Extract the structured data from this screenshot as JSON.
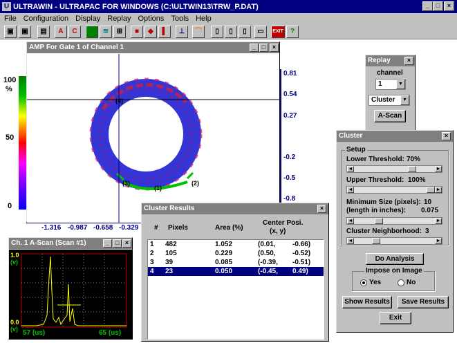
{
  "app": {
    "title": "ULTRAWIN - ULTRAPAC FOR WINDOWS   (C:\\ULTWIN13\\TRW_P.DAT)",
    "logo_letter": "U"
  },
  "menu": [
    "File",
    "Configuration",
    "Display",
    "Replay",
    "Options",
    "Tools",
    "Help"
  ],
  "toolbar": {
    "buttons": [
      "save-icon",
      "save-as-icon",
      "print-icon",
      "A",
      "C",
      "chart-icon",
      "scan-icon",
      "probe-icon",
      "record-icon",
      "diamond-icon",
      "marker-icon",
      "plot-icon",
      "rainbow-icon",
      "gauge-icon",
      "gauge-icon",
      "gauge-icon",
      "keyboard-icon",
      "EXIT",
      "?"
    ]
  },
  "amp_window": {
    "title": "AMP For Gate 1 of Channel 1",
    "colorbar_labels": [
      "100",
      "%",
      "50",
      "0"
    ],
    "y_ticks": [
      "0.81",
      "0.54",
      "0.27",
      "-0.2",
      "-0.5",
      "-0.8"
    ],
    "x_ticks": [
      "-1.316",
      "-0.987",
      "-0.658",
      "-0.329"
    ],
    "cluster_markers": [
      "(4)",
      "(3)",
      "(1)",
      "(2)"
    ]
  },
  "ascan_window": {
    "title": "Ch. 1 A-Scan (Scan #1)",
    "y_top": "1.0",
    "y_top_unit": "(v)",
    "y_bottom": "0.0",
    "y_bottom_unit": "(v)",
    "x_start": "57 (us)",
    "x_end": "65 (us)"
  },
  "replay": {
    "title": "Replay",
    "channel_label": "channel",
    "channel_value": "1",
    "mode_value": "Cluster",
    "ascan_button": "A-Scan"
  },
  "cluster_results": {
    "title": "Cluster Results",
    "headers": [
      "#",
      "Pixels",
      "Area (%)",
      "Center Posi.",
      "(x, y)"
    ],
    "rows": [
      {
        "n": "1",
        "pixels": "482",
        "area": "1.052",
        "x": "(0.01,",
        "y": "-0.66)"
      },
      {
        "n": "2",
        "pixels": "105",
        "area": "0.229",
        "x": "(0.50,",
        "y": "-0.52)"
      },
      {
        "n": "3",
        "pixels": "39",
        "area": "0.085",
        "x": "(-0.39,",
        "y": "-0.51)"
      },
      {
        "n": "4",
        "pixels": "23",
        "area": "0.050",
        "x": "(-0.45,",
        "y": "0.49)"
      }
    ],
    "selected_row": 3
  },
  "cluster": {
    "title": "Cluster",
    "setup_label": "Setup",
    "lower_label": "Lower Threshold:",
    "lower_value": "70%",
    "lower_fraction": 0.7,
    "upper_label": "Upper Threshold:",
    "upper_value": "100%",
    "upper_fraction": 1.0,
    "min_size_label": "Minimum Size (pixels):",
    "min_size_value": "10",
    "length_label": "(length in inches):",
    "length_value": "0.075",
    "neighborhood_label": "Cluster Neighborhood:",
    "neighborhood_value": "3",
    "do_analysis": "Do Analysis",
    "impose_label": "Impose on Image",
    "yes_label": "Yes",
    "no_label": "No",
    "impose_selected": "Yes",
    "show_results": "Show Results",
    "save_results": "Save Results",
    "exit": "Exit"
  },
  "colors": {
    "title_active": "#000080",
    "title_inactive": "#808080",
    "face": "#c0c0c0",
    "selection": "#000080"
  }
}
